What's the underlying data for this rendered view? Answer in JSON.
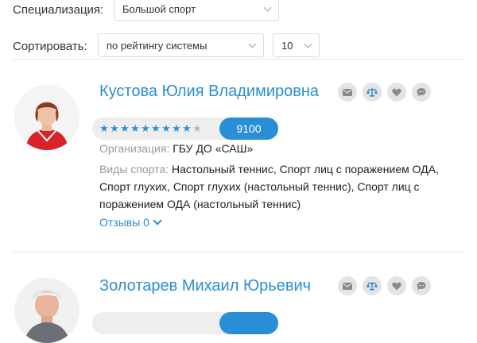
{
  "filters": {
    "specialization_label": "Специализация:",
    "specialization_value": "Большой спорт",
    "sort_label": "Сортировать:",
    "sort_value": "по рейтингу системы",
    "per_page_value": "10"
  },
  "coaches": [
    {
      "name": "Кустова Юлия Владимировна",
      "rating_stars": 9,
      "rating_max": 10,
      "score": "9100",
      "org_label": "Организация:",
      "org_value": "ГБУ ДО «САШ»",
      "sports_label": "Виды спорта:",
      "sports_value": "Настольный теннис, Спорт лиц с поражением ОДА, Спорт глухих, Спорт глухих (настольный теннис), Спорт лиц с поражением ОДА (настольный теннис)",
      "reviews": "Отзывы 0"
    },
    {
      "name": "Золотарев Михаил Юрьевич"
    }
  ],
  "icons": [
    "envelope-icon",
    "scales-icon",
    "heart-icon",
    "chat-icon",
    "chevron-down-icon"
  ],
  "colors": {
    "accent": "#2a8ed6",
    "muted": "#9a9a9a",
    "pill": "#eeeeee"
  }
}
